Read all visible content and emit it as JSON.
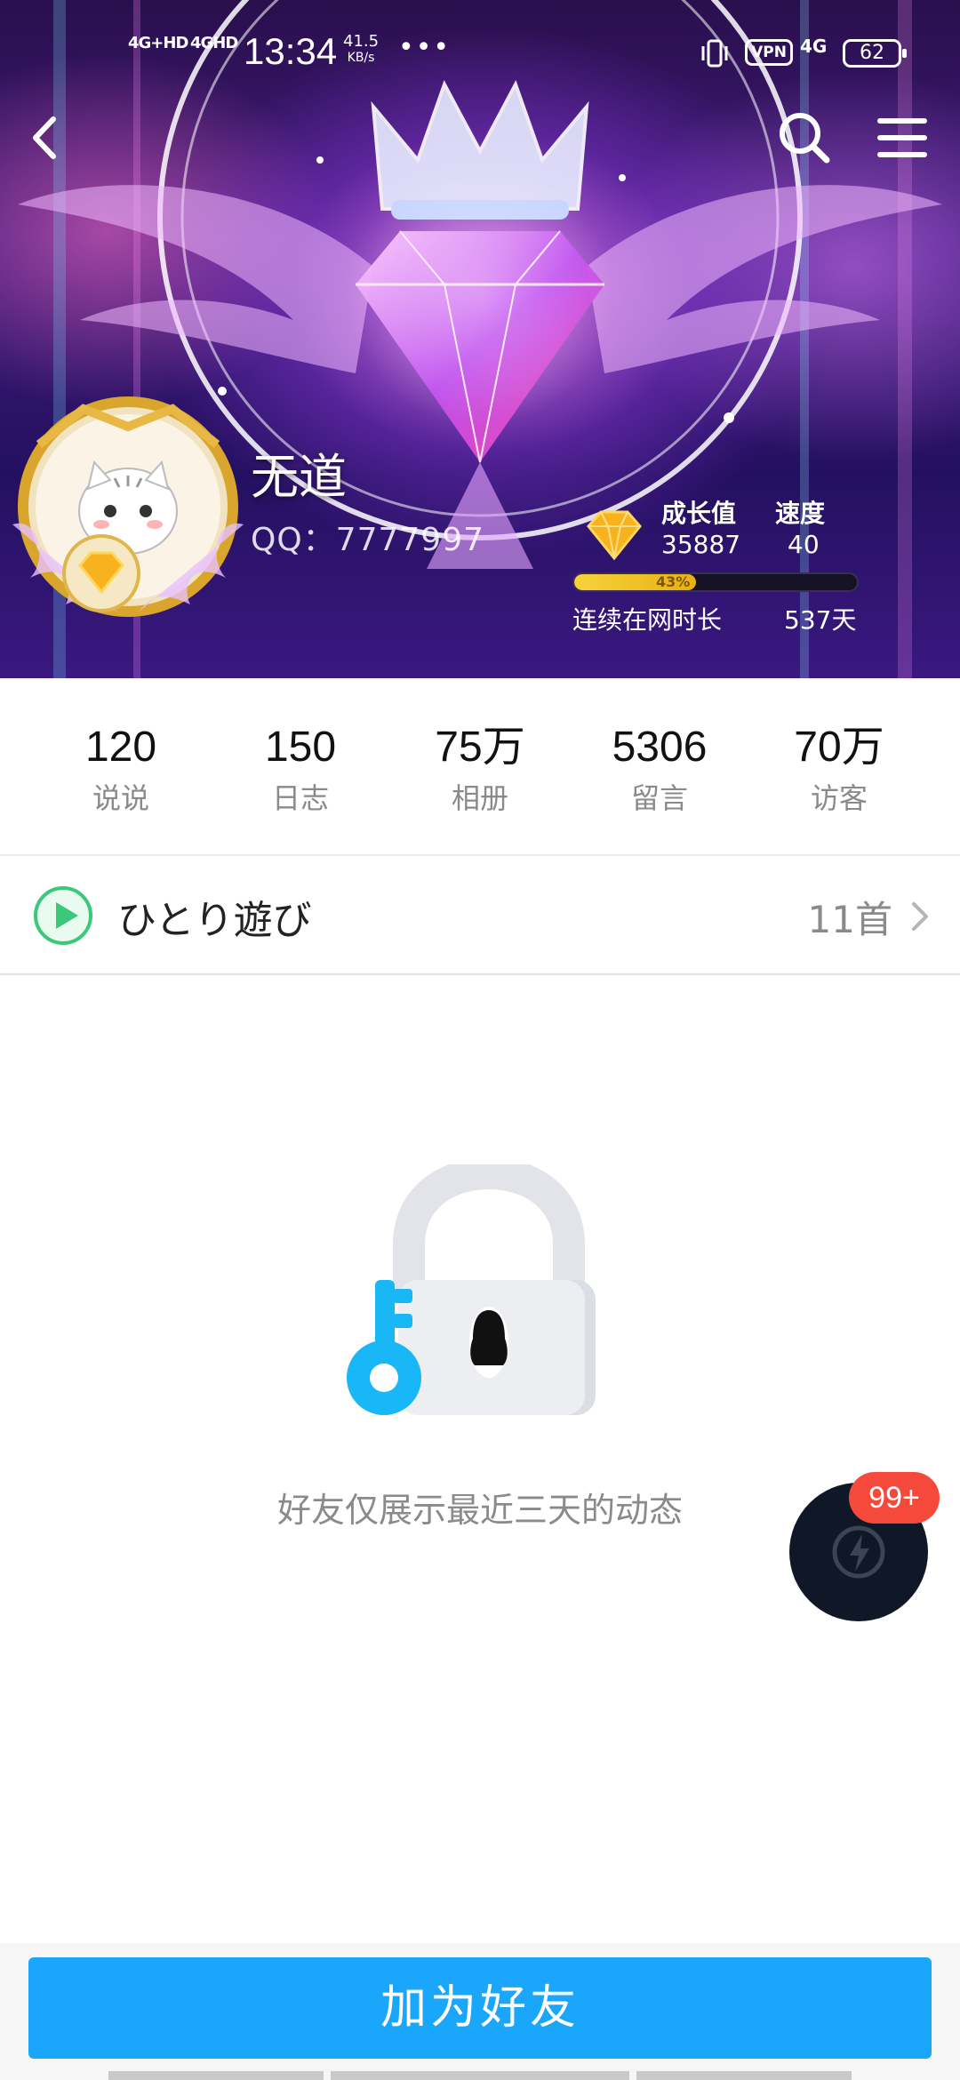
{
  "status_bar": {
    "net1": "4G+HD",
    "net2": "4GHD",
    "time": "13:34",
    "speed_value": "41.5",
    "speed_unit": "KB/s",
    "more": "•••",
    "vpn": "VPN",
    "net3": "4G",
    "battery": "62"
  },
  "profile": {
    "nickname": "无道",
    "qq": "QQ：7777997",
    "growth_label": "成长值",
    "growth_value": "35887",
    "speed_label": "速度",
    "speed_value": "40",
    "level_progress_text": "43%",
    "level_progress": 0.43,
    "online_label": "连续在网时长",
    "online_value": "537天"
  },
  "stats": [
    {
      "value": "120",
      "label": "说说"
    },
    {
      "value": "150",
      "label": "日志"
    },
    {
      "value": "75万",
      "label": "相册"
    },
    {
      "value": "5306",
      "label": "留言"
    },
    {
      "value": "70万",
      "label": "访客"
    }
  ],
  "music": {
    "title": "ひとり遊び",
    "count": "11首"
  },
  "empty_state": {
    "message": "好友仅展示最近三天的动态"
  },
  "fab": {
    "badge": "99+"
  },
  "actions": {
    "add_friend": "加为好友"
  },
  "colors": {
    "accent": "#1aa6fb",
    "badge": "#f54a3b",
    "level_bar": "#f7d23c",
    "play_green": "#3cc87a"
  }
}
